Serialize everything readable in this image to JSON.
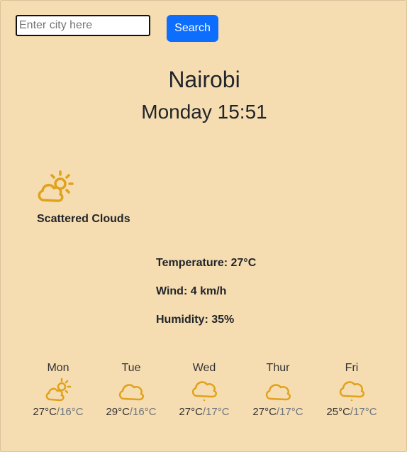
{
  "search": {
    "placeholder": "Enter city here",
    "button_label": "Search"
  },
  "location": {
    "city": "Nairobi",
    "datetime": "Monday 15:51"
  },
  "current": {
    "icon": "sun-behind-cloud-icon",
    "condition": "Scattered Clouds",
    "temperature": "Temperature: 27°C",
    "wind": "Wind: 4 km/h",
    "humidity": "Humidity: 35%"
  },
  "forecast": [
    {
      "day": "Mon",
      "icon": "sun-behind-cloud-icon",
      "high": "27°C",
      "low": "16°C"
    },
    {
      "day": "Tue",
      "icon": "cloud-icon",
      "high": "29°C",
      "low": "16°C"
    },
    {
      "day": "Wed",
      "icon": "cloud-drizzle-icon",
      "high": "27°C",
      "low": "17°C"
    },
    {
      "day": "Thur",
      "icon": "cloud-icon",
      "high": "27°C",
      "low": "17°C"
    },
    {
      "day": "Fri",
      "icon": "cloud-drizzle-icon",
      "high": "25°C",
      "low": "17°C"
    }
  ],
  "colors": {
    "background": "#f5dcb1",
    "accent": "#0d6efd",
    "icon": "#e0a21b"
  }
}
